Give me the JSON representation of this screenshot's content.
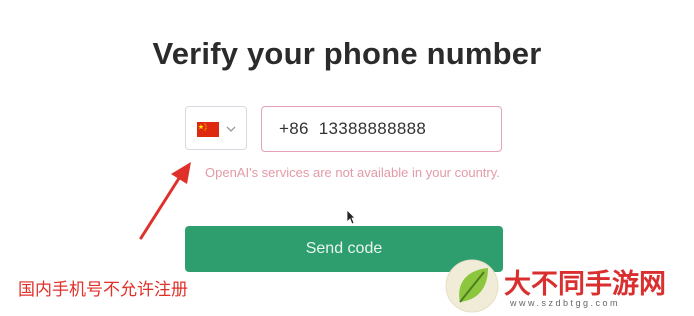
{
  "page": {
    "title": "Verify your phone number"
  },
  "country_select": {
    "flag_icon": "china-flag-icon",
    "chevron_icon": "chevron-down-icon"
  },
  "phone": {
    "value": "+86  13388888888"
  },
  "error": {
    "message": "OpenAI's services are not available in your country."
  },
  "send_button": {
    "label": "Send code"
  },
  "annotation": {
    "text": "国内手机号不允许注册",
    "color": "#e0302a"
  },
  "watermark": {
    "brand": "大不同手游网",
    "url": "www.szdbtgg.com"
  },
  "colors": {
    "accent_green": "#2f9e6f",
    "error_pink": "#e39aa6",
    "field_error_border": "#e3a3b4"
  }
}
